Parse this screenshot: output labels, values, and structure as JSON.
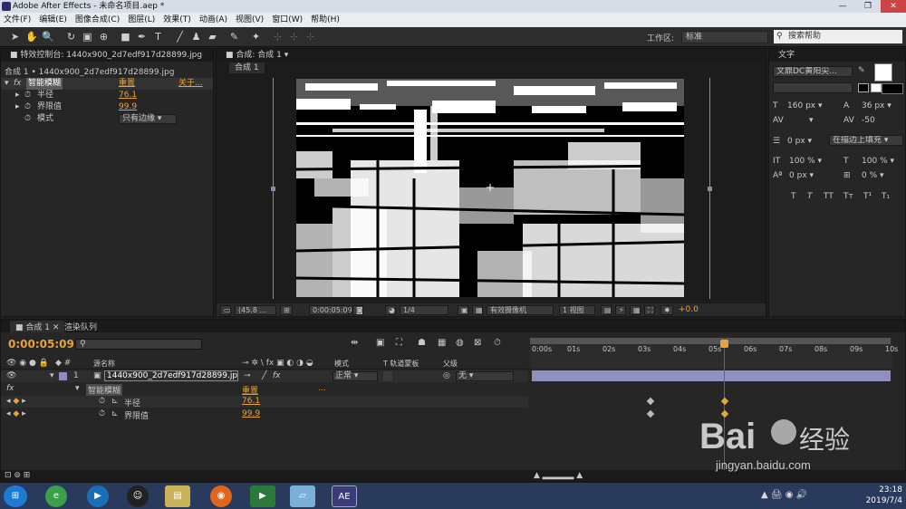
{
  "window": {
    "title": "Adobe After Effects - 未命名项目.aep *"
  },
  "menu": [
    "文件(F)",
    "编辑(E)",
    "图像合成(C)",
    "图层(L)",
    "效果(T)",
    "动画(A)",
    "视图(V)",
    "窗口(W)",
    "帮助(H)"
  ],
  "toolbar": {
    "workspace_label": "工作区:",
    "workspace_value": "标准",
    "search_placeholder": "搜索帮助"
  },
  "effects_panel": {
    "tab": "特效控制台: 1440x900_2d7edf917d28899.jpg",
    "subtitle": "合成 1 • 1440x900_2d7edf917d28899.jpg",
    "effect_name": "智能模糊",
    "reset": "重置",
    "about": "关于...",
    "props": [
      {
        "name": "半径",
        "value": "76.1"
      },
      {
        "name": "界限值",
        "value": "99.9"
      },
      {
        "name": "模式",
        "value": "只有边缘"
      }
    ]
  },
  "comp_panel": {
    "tab": "合成: 合成 1",
    "subtab": "合成 1",
    "footer": {
      "zoom": "(45.8 ...",
      "timecode": "0:00:05:09",
      "resolution": "1/4",
      "camera": "有效摄像机",
      "views": "1 视图",
      "offset": "+0.0"
    }
  },
  "text_panel": {
    "tab": "文字",
    "font": "文鼎DC黄阳尖...",
    "size": "160",
    "size_unit": "px",
    "leading": "36",
    "leading_unit": "px",
    "tracking": "-50",
    "stroke": "0",
    "stroke_unit": "px",
    "stroke_mode": "在描边上填充",
    "vscale": "100",
    "vscale_unit": "%",
    "hscale": "100",
    "hscale_unit": "%",
    "baseline": "0",
    "baseline_unit": "px",
    "tsume": "0",
    "tsume_unit": "%",
    "styles": [
      "T",
      "T",
      "TT",
      "Tт",
      "T¹",
      "T₁"
    ]
  },
  "timeline": {
    "tabs": [
      "合成 1",
      "渲染队列"
    ],
    "timecode": "0:00:05:09",
    "col_source": "源名称",
    "col_mode": "模式",
    "col_trkmat": "T 轨道蒙板",
    "col_parent": "父级",
    "layer": {
      "index": "1",
      "name": "1440x900_2d7edf917d28899.jpg",
      "mode": "正常",
      "parent": "无"
    },
    "effect": {
      "label": "fx",
      "name": "智能模糊",
      "reset": "重置",
      "more": "..."
    },
    "props": [
      {
        "name": "半径",
        "value": "76.1"
      },
      {
        "name": "界限值",
        "value": "99.9"
      }
    ],
    "ruler": [
      "0:00s",
      "01s",
      "02s",
      "03s",
      "04s",
      "05s",
      "06s",
      "07s",
      "08s",
      "09s",
      "10s"
    ]
  },
  "tray": {
    "time": "23:18",
    "date": "2019/7/4"
  },
  "watermark": {
    "text": "jingyan.baidu.com"
  },
  "colors": {
    "accent": "#e8a33a",
    "panel": "#262626",
    "taskbar": "#2a3a5c",
    "playhead": "#e03030"
  }
}
